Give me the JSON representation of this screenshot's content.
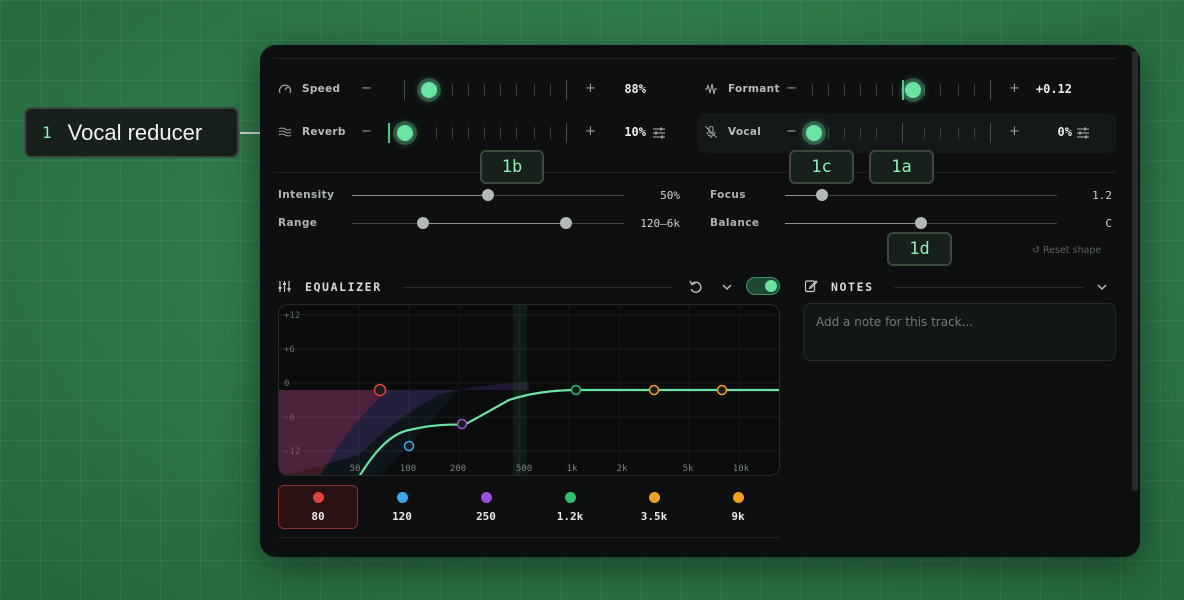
{
  "callouts": {
    "main_number": "1",
    "main_label": "Vocal reducer",
    "c1a": "1a",
    "c1b": "1b",
    "c1c": "1c",
    "c1d": "1d"
  },
  "effects": {
    "speed": {
      "label": "Speed",
      "minus": "−",
      "plus": "+",
      "value": "88%"
    },
    "reverb": {
      "label": "Reverb",
      "minus": "−",
      "plus": "+",
      "value": "10%"
    },
    "formant": {
      "label": "Formant",
      "minus": "−",
      "plus": "+",
      "value": "+0.12"
    },
    "vocal": {
      "label": "Vocal",
      "minus": "−",
      "plus": "+",
      "value": "0%"
    }
  },
  "shape": {
    "intensity": {
      "label": "Intensity",
      "value": "50%",
      "level": 0.5
    },
    "range": {
      "label": "Range",
      "value": "120–6k"
    },
    "focus": {
      "label": "Focus",
      "value": "1.2",
      "level": 0.12
    },
    "balance": {
      "label": "Balance",
      "value": "C",
      "level": 0.5
    },
    "reset_label": "Reset shape"
  },
  "equalizer": {
    "title": "EQUALIZER",
    "enabled": true,
    "y_labels": [
      "+12",
      "+6",
      "0",
      "-6",
      "-12"
    ],
    "x_labels": [
      "50",
      "100",
      "200",
      "500",
      "1k",
      "2k",
      "5k",
      "10k"
    ],
    "bands": [
      {
        "freq": "80",
        "color": "#e0443e",
        "active": true
      },
      {
        "freq": "120",
        "color": "#3aa8e8",
        "active": false
      },
      {
        "freq": "250",
        "color": "#9b4fe0",
        "active": false
      },
      {
        "freq": "1.2k",
        "color": "#2fbf6a",
        "active": false
      },
      {
        "freq": "3.5k",
        "color": "#f0a020",
        "active": false
      },
      {
        "freq": "9k",
        "color": "#f0a020",
        "active": false
      }
    ]
  },
  "notes": {
    "title": "NOTES",
    "placeholder": "Add a note for this track..."
  },
  "colors": {
    "accent": "#6be3a2",
    "background": "#0d0f10"
  }
}
